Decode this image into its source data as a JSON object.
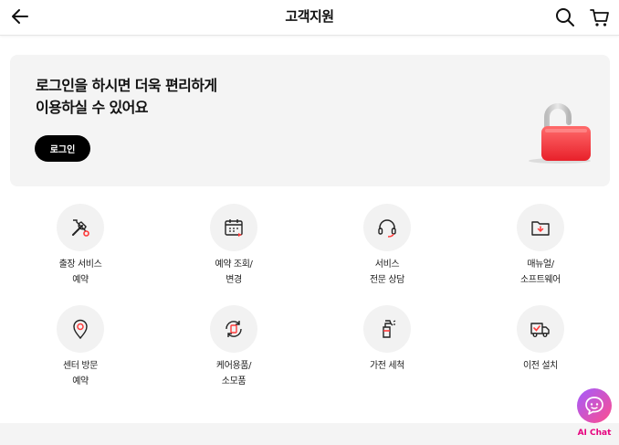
{
  "header": {
    "title": "고객지원",
    "back_icon": "arrow-left-icon",
    "search_icon": "search-icon",
    "cart_icon": "cart-icon"
  },
  "login_card": {
    "message_line1": "로그인을 하시면 더욱 편리하게",
    "message_line2": "이용하실 수 있어요",
    "button_label": "로그인",
    "illustration": "red-padlock",
    "accent_color": "#ff3b3b"
  },
  "menu": [
    {
      "line1": "출장 서비스",
      "line2": "예약",
      "icon": "tools-icon"
    },
    {
      "line1": "예약 조회/",
      "line2": "변경",
      "icon": "calendar-icon"
    },
    {
      "line1": "서비스",
      "line2": "전문 상담",
      "icon": "headset-icon"
    },
    {
      "line1": "매뉴얼/",
      "line2": "소프트웨어",
      "icon": "folder-download-icon"
    },
    {
      "line1": "센터 방문",
      "line2": "예약",
      "icon": "location-pin-icon"
    },
    {
      "line1": "케어용품/",
      "line2": "소모품",
      "icon": "refresh-device-icon"
    },
    {
      "line1": "가전 세척",
      "line2": "",
      "icon": "spray-cleaner-icon"
    },
    {
      "line1": "이전 설치",
      "line2": "",
      "icon": "delivery-truck-icon"
    }
  ],
  "ai_chat": {
    "label": "AI Chat",
    "icon": "chat-bubble-icon"
  }
}
